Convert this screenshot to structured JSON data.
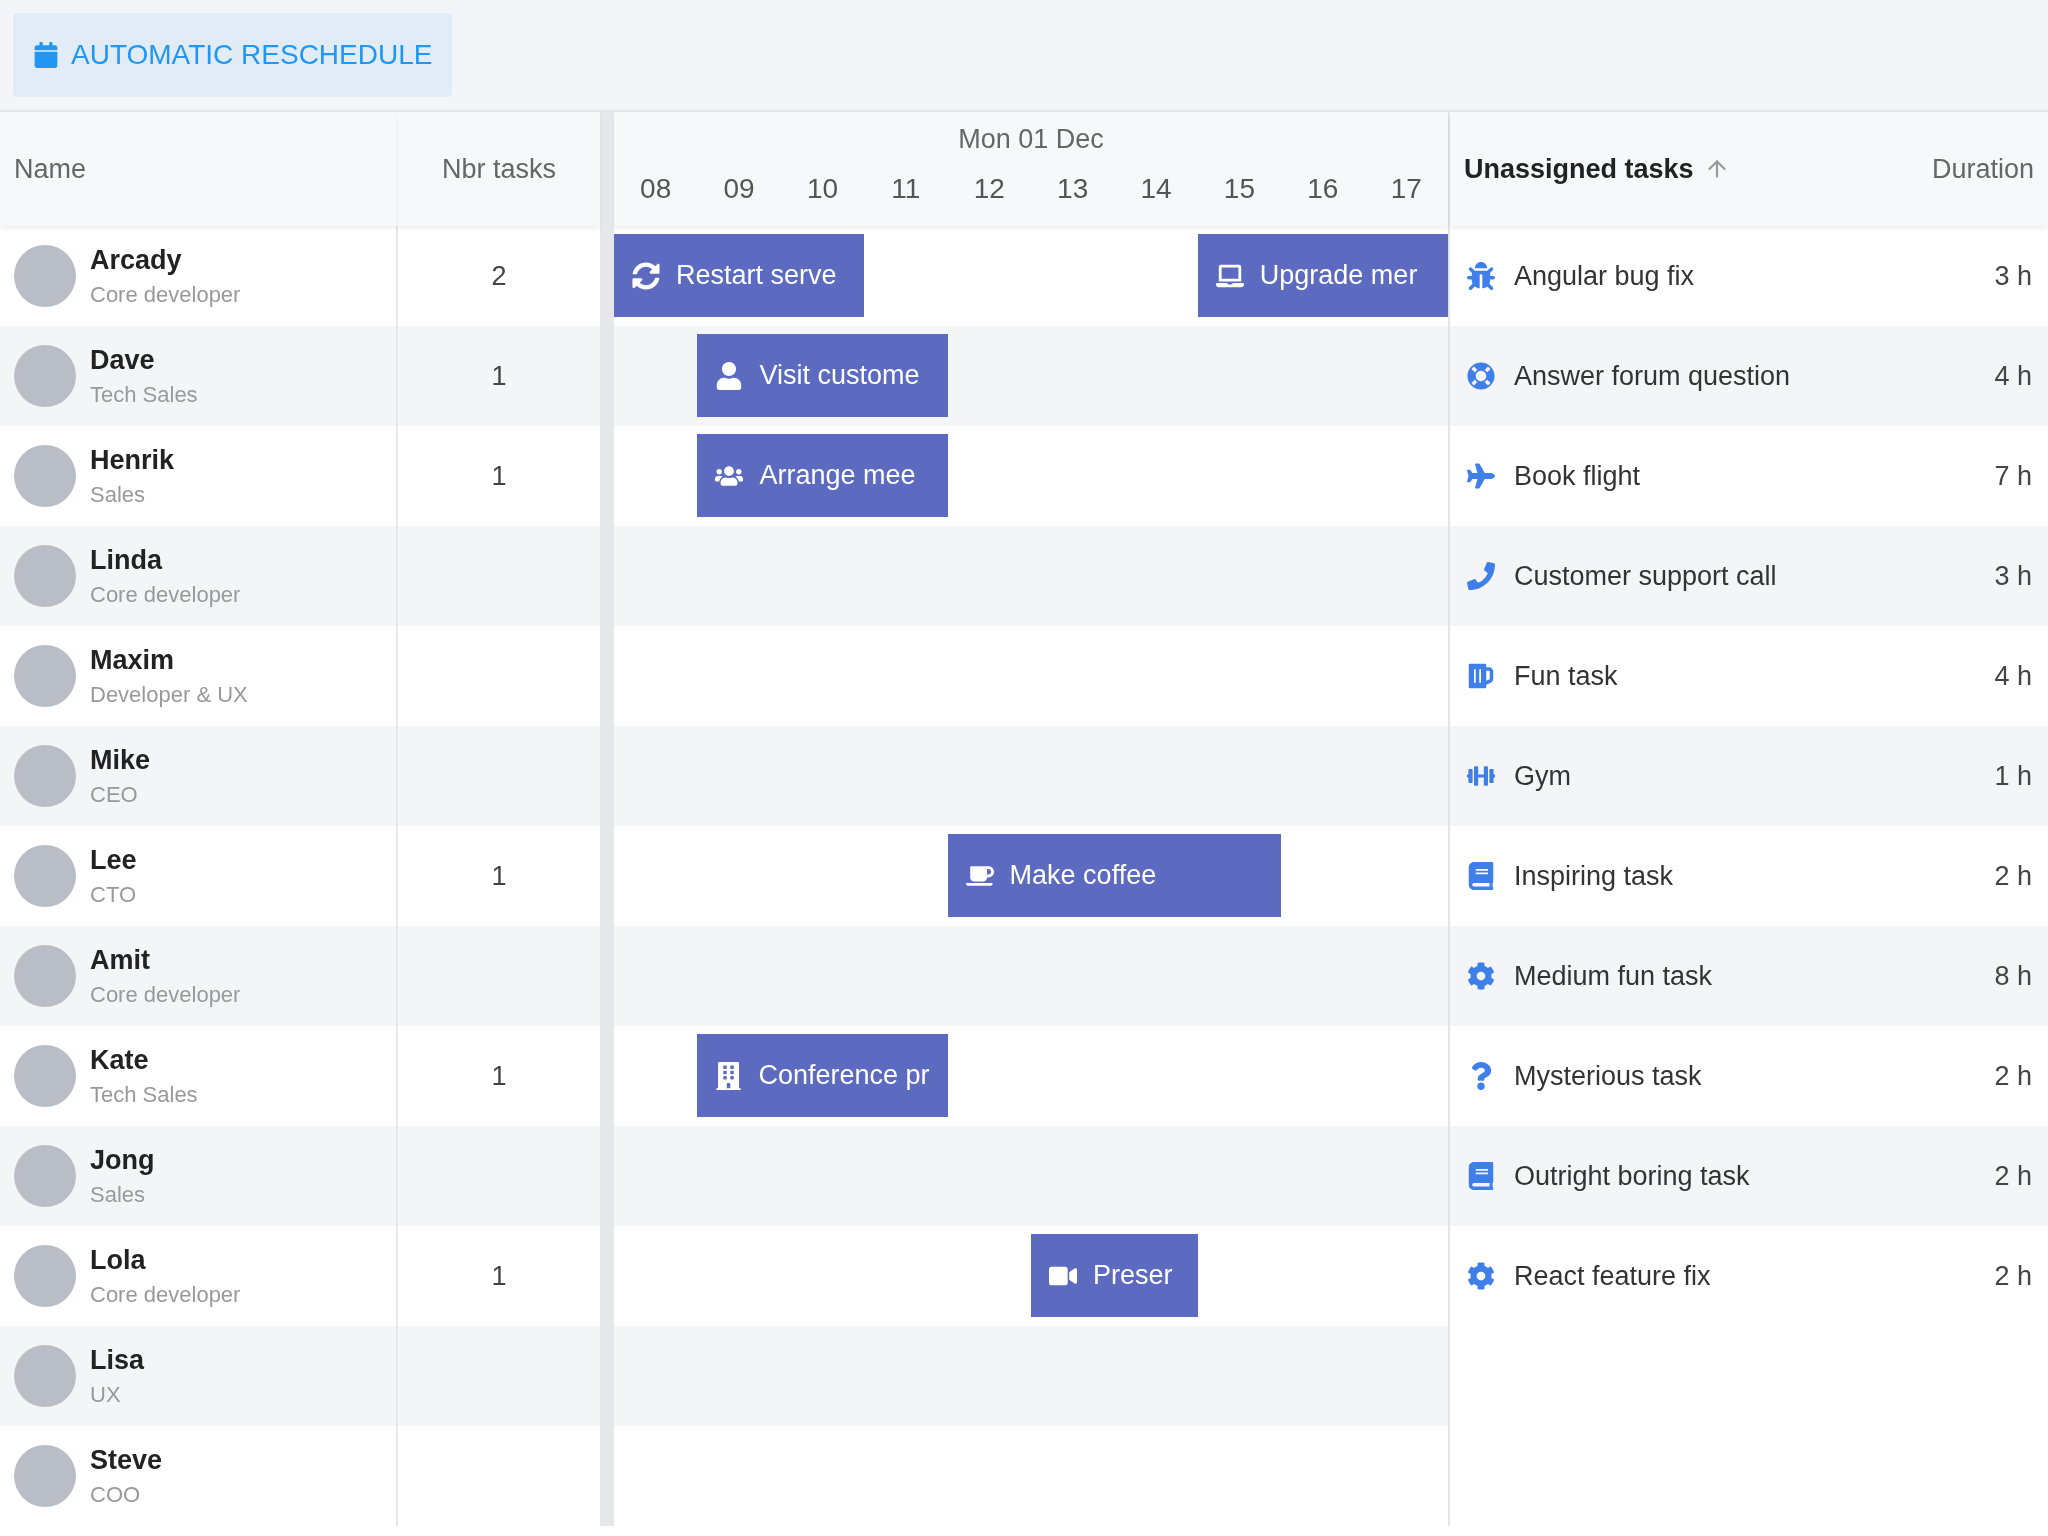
{
  "toolbar": {
    "button": "AUTOMATIC RESCHEDULE"
  },
  "columns": {
    "name": "Name",
    "tasks": "Nbr tasks"
  },
  "timeline": {
    "date": "Mon 01 Dec",
    "hours": [
      "08",
      "09",
      "10",
      "11",
      "12",
      "13",
      "14",
      "15",
      "16",
      "17"
    ]
  },
  "resources": [
    {
      "name": "Arcady",
      "role": "Core developer",
      "tasks": "2",
      "events": [
        {
          "kind": "refresh",
          "label": "Restart serve"
        },
        {
          "kind": "laptop",
          "label": "Upgrade mer"
        }
      ]
    },
    {
      "name": "Dave",
      "role": "Tech Sales",
      "tasks": "1",
      "events": [
        {
          "kind": "user",
          "label": "Visit custome"
        }
      ]
    },
    {
      "name": "Henrik",
      "role": "Sales",
      "tasks": "1",
      "events": [
        {
          "kind": "users",
          "label": "Arrange mee"
        }
      ]
    },
    {
      "name": "Linda",
      "role": "Core developer"
    },
    {
      "name": "Maxim",
      "role": "Developer & UX"
    },
    {
      "name": "Mike",
      "role": "CEO"
    },
    {
      "name": "Lee",
      "role": "CTO",
      "tasks": "1",
      "events": [
        {
          "kind": "coffee",
          "label": "Make coffee"
        }
      ]
    },
    {
      "name": "Amit",
      "role": "Core developer"
    },
    {
      "name": "Kate",
      "role": "Tech Sales",
      "tasks": "1",
      "events": [
        {
          "kind": "building",
          "label": "Conference pr"
        }
      ]
    },
    {
      "name": "Jong",
      "role": "Sales"
    },
    {
      "name": "Lola",
      "role": "Core developer",
      "tasks": "1",
      "events": [
        {
          "kind": "video",
          "label": "Preser"
        }
      ]
    },
    {
      "name": "Lisa",
      "role": "UX"
    },
    {
      "name": "Steve",
      "role": "COO"
    }
  ],
  "unassigned": {
    "title": "Unassigned tasks",
    "duration_header": "Duration",
    "tasks": [
      {
        "kind": "bug",
        "name": "Angular bug fix",
        "duration": "3 h"
      },
      {
        "kind": "lifering",
        "name": "Answer forum question",
        "duration": "4 h"
      },
      {
        "kind": "plane",
        "name": "Book flight",
        "duration": "7 h"
      },
      {
        "kind": "phone",
        "name": "Customer support call",
        "duration": "3 h"
      },
      {
        "kind": "mug",
        "name": "Fun task",
        "duration": "4 h"
      },
      {
        "kind": "dumbbell",
        "name": "Gym",
        "duration": "1 h"
      },
      {
        "kind": "book",
        "name": "Inspiring task",
        "duration": "2 h"
      },
      {
        "kind": "cog",
        "name": "Medium fun task",
        "duration": "8 h"
      },
      {
        "kind": "question",
        "name": "Mysterious task",
        "duration": "2 h"
      },
      {
        "kind": "book",
        "name": "Outright boring task",
        "duration": "2 h"
      },
      {
        "kind": "cog",
        "name": "React feature fix",
        "duration": "2 h"
      }
    ]
  }
}
